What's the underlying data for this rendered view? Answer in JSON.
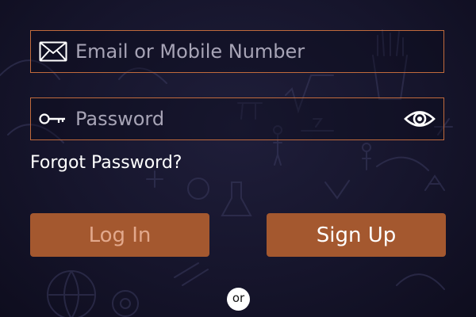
{
  "login_form": {
    "email": {
      "placeholder": "Email or Mobile Number",
      "value": "",
      "icon": "mail-icon"
    },
    "password": {
      "placeholder": "Password",
      "value": "",
      "icon": "key-icon",
      "toggle_icon": "eye-icon"
    },
    "forgot_password_label": "Forgot Password?",
    "login_label": "Log In",
    "signup_label": "Sign Up",
    "divider_label": "or"
  },
  "colors": {
    "background": "#16152c",
    "field_border": "#c06a3c",
    "button_bg": "#a4582f",
    "login_text": "#e2a88c",
    "signup_text": "#ffffff",
    "placeholder_text": "#a7a4b6"
  }
}
